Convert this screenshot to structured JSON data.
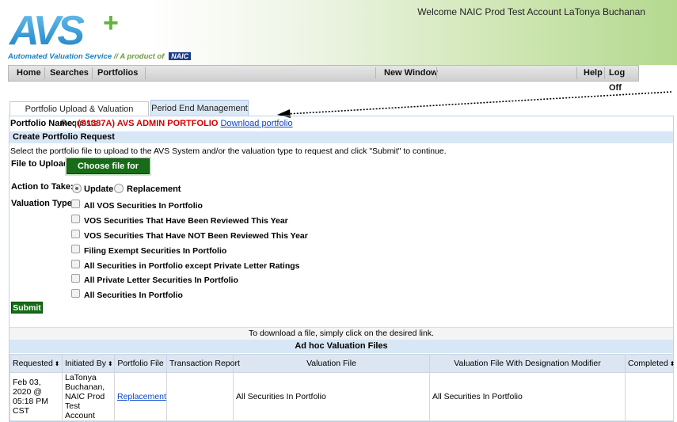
{
  "header": {
    "welcome_text": "Welcome NAIC Prod Test Account LaTonya Buchanan",
    "logo_text": "AVS+",
    "tagline_main": "Automated Valuation Service",
    "tagline_sep": "//",
    "tagline_product": "A product of",
    "tagline_badge": "NAIC"
  },
  "nav": {
    "home": "Home",
    "searches": "Searches",
    "portfolios": "Portfolios",
    "new_window": "New Window",
    "help": "Help",
    "logoff": "Log Off"
  },
  "tabs": {
    "upload": "Portfolio Upload & Valuation Requests",
    "period_end": "Period End Management"
  },
  "portfolio": {
    "label": "Portfolio Name:",
    "name": "(S1387A) AVS ADMIN PORTFOLIO",
    "download_link": "Download portfolio"
  },
  "form": {
    "section_title": "Create Portfolio Request",
    "instructions": "Select the portfolio file to upload to the AVS System and/or the valuation type to request and click \"Submit\" to continue.",
    "file_label": "File to Upload:",
    "upload_button": "Choose file for upload",
    "action_label": "Action to Take:",
    "action_update": "Update",
    "action_replacement": "Replacement",
    "action_selected": "Update",
    "valuation_label": "Valuation Type:",
    "valuation_options": [
      "All VOS Securities In Portfolio",
      "VOS Securities That Have Been Reviewed This Year",
      "VOS Securities That Have NOT Been Reviewed This Year",
      "Filing Exempt Securities In Portfolio",
      "All Securities in Portfolio except Private Letter Ratings",
      "All Private Letter Securities In Portfolio",
      "All Securities In Portfolio"
    ],
    "submit": "Submit"
  },
  "files": {
    "download_note": "To download a file, simply click on the desired link.",
    "title": "Ad hoc Valuation Files",
    "columns": [
      "Requested",
      "Initiated By",
      "Portfolio File",
      "Transaction Report",
      "Valuation File",
      "Valuation File With Designation Modifier",
      "Completed"
    ],
    "sort_glyph": "⬍",
    "rows": [
      {
        "requested": "Feb 03, 2020 @ 05:18 PM CST",
        "initiated_by": "LaTonya Buchanan, NAIC Prod Test Account",
        "portfolio_file": "Replacement",
        "transaction_report": "",
        "valuation_file": "All Securities In Portfolio",
        "valuation_modifier": "All Securities In Portfolio",
        "completed": ""
      }
    ]
  },
  "colors": {
    "green_button": "#176d17",
    "section_blue": "#d8e7f6",
    "portfolio_red": "#d40000",
    "link_blue": "#0b45c8"
  }
}
